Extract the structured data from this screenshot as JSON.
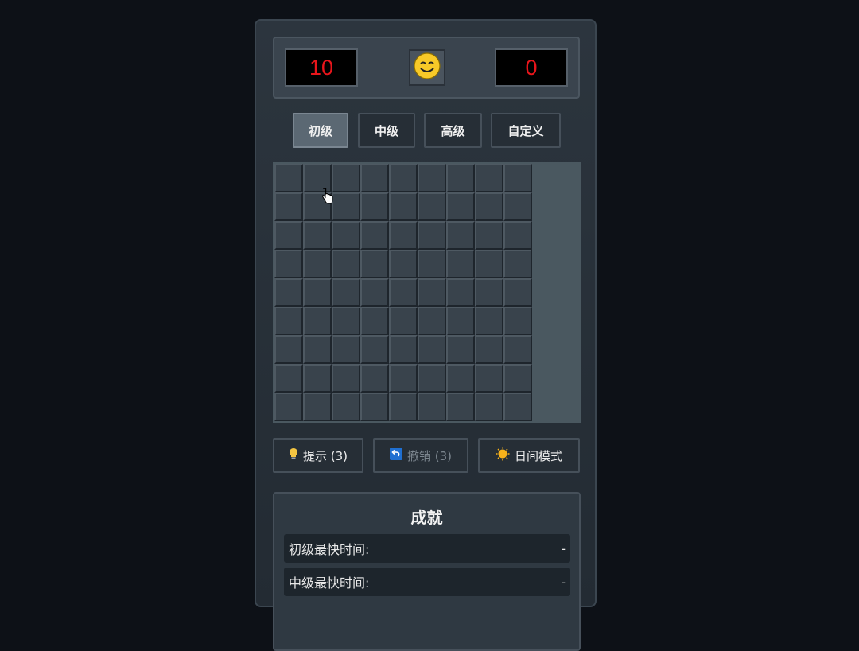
{
  "counter": {
    "mines": "10",
    "timer": "0"
  },
  "face": {
    "icon": "smiley-face-icon"
  },
  "difficulty": [
    {
      "label": "初级",
      "active": true
    },
    {
      "label": "中级",
      "active": false
    },
    {
      "label": "高级",
      "active": false
    },
    {
      "label": "自定义",
      "active": false
    }
  ],
  "board": {
    "rows": 9,
    "cols": 9
  },
  "tools": {
    "hint_label": "提示 (3)",
    "undo_label": "撤销 (3)",
    "mode_label": "日间模式"
  },
  "achievements": {
    "title": "成就",
    "rows": [
      {
        "label": "初级最快时间:",
        "value": "-"
      },
      {
        "label": "中级最快时间:",
        "value": "-"
      }
    ]
  }
}
